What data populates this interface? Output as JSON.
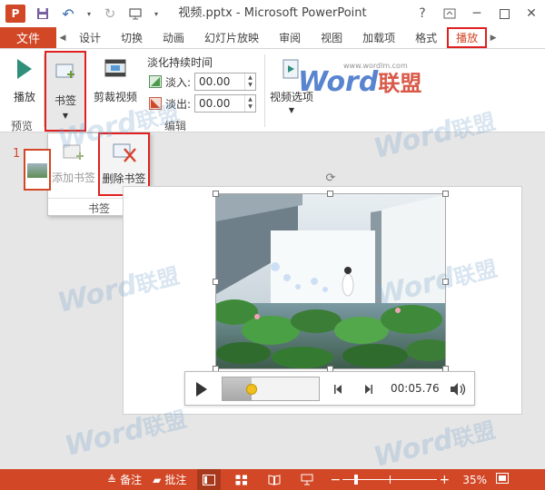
{
  "window": {
    "title": "视频.pptx - Microsoft PowerPoint",
    "help": "?",
    "app_logo": "P"
  },
  "tabs": {
    "file": "文件",
    "items": [
      "设计",
      "切换",
      "动画",
      "幻灯片放映",
      "审阅",
      "视图",
      "加载项",
      "格式"
    ],
    "active": "播放"
  },
  "ribbon": {
    "play": "播放",
    "bookmark": "书签",
    "trim": "剪裁视频",
    "fade_title": "淡化持续时间",
    "fade_in_label": "淡入:",
    "fade_in_value": "00.00",
    "fade_out_label": "淡出:",
    "fade_out_value": "00.00",
    "video_options": "视频选项",
    "group_preview": "预览",
    "group_edit": "编辑"
  },
  "bookmark_menu": {
    "add": "添加书签",
    "remove": "删除书签",
    "group": "书签"
  },
  "slides": {
    "current_number": "1"
  },
  "player": {
    "time": "00:05.76",
    "progress": 0.3
  },
  "status": {
    "notes": "备注",
    "comments": "批注",
    "zoom": "35%",
    "zoom_level": 0.35
  },
  "watermark": {
    "word": "Word",
    "cn": "联盟",
    "url": "www.wordlm.com"
  },
  "colors": {
    "accent": "#d24726",
    "highlight": "#e02020"
  }
}
